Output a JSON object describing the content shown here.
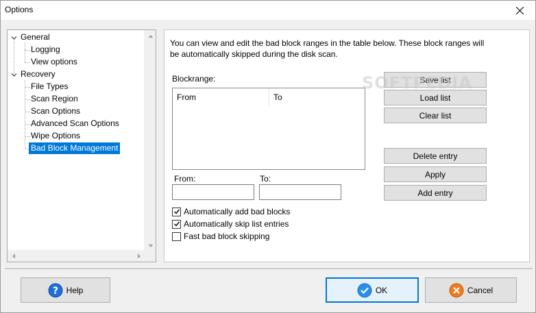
{
  "window": {
    "title": "Options"
  },
  "tree": {
    "items": [
      {
        "label": "General",
        "level": 0,
        "expanded": true,
        "selected": false
      },
      {
        "label": "Logging",
        "level": 1,
        "selected": false
      },
      {
        "label": "View options",
        "level": 1,
        "selected": false
      },
      {
        "label": "Recovery",
        "level": 0,
        "expanded": true,
        "selected": false
      },
      {
        "label": "File Types",
        "level": 1,
        "selected": false
      },
      {
        "label": "Scan Region",
        "level": 1,
        "selected": false
      },
      {
        "label": "Scan Options",
        "level": 1,
        "selected": false
      },
      {
        "label": "Advanced Scan Options",
        "level": 1,
        "selected": false
      },
      {
        "label": "Wipe Options",
        "level": 1,
        "selected": false
      },
      {
        "label": "Bad Block Management",
        "level": 1,
        "selected": true
      }
    ]
  },
  "content": {
    "description": "You can view and edit the bad block ranges in the table below. These block ranges will be automatically skipped during the disk scan.",
    "blockrange_label": "Blockrange:",
    "columns": [
      "From",
      "To"
    ],
    "from_label": "From:",
    "to_label": "To:",
    "from_value": "",
    "to_value": "",
    "buttons": {
      "save": "Save list",
      "load": "Load list",
      "clear": "Clear list",
      "delete": "Delete entry",
      "apply": "Apply",
      "add": "Add entry"
    },
    "checkboxes": [
      {
        "label": "Automatically add bad blocks",
        "checked": true
      },
      {
        "label": "Automatically skip list entries",
        "checked": true
      },
      {
        "label": "Fast bad block skipping",
        "checked": false
      }
    ]
  },
  "footer": {
    "help": "Help",
    "ok": "OK",
    "cancel": "Cancel"
  },
  "watermark": "SOFTPEDIA",
  "colors": {
    "accent": "#0078d7",
    "help_icon": "#1e6fd9",
    "ok_icon": "#2a8ee8",
    "cancel_icon": "#f07a1e"
  }
}
